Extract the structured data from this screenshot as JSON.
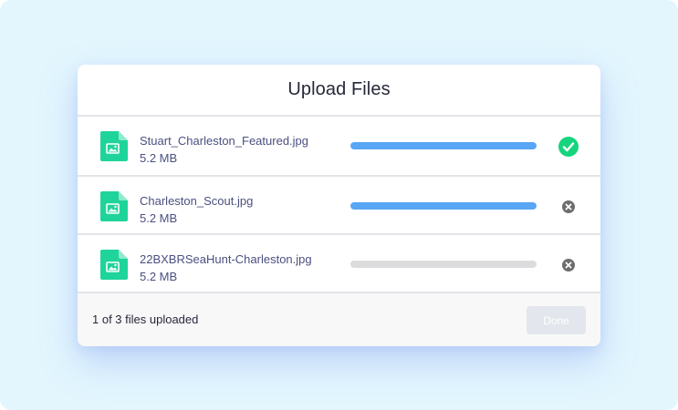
{
  "dialog": {
    "title": "Upload Files"
  },
  "files": [
    {
      "name": "Stuart_Charleston_Featured.jpg",
      "size": "5.2 MB",
      "progress": 1.0,
      "status": "complete",
      "status_icon": "check-circle-icon",
      "file_icon": "image-file-icon"
    },
    {
      "name": "Charleston_Scout.jpg",
      "size": "5.2 MB",
      "progress": 1.0,
      "status": "removable",
      "status_icon": "remove-circle-icon",
      "file_icon": "image-file-icon"
    },
    {
      "name": "22BXBRSeaHunt-Charleston.jpg",
      "size": "5.2 MB",
      "progress": 0.0,
      "status": "removable",
      "status_icon": "remove-circle-icon",
      "file_icon": "image-file-icon"
    }
  ],
  "footer": {
    "status_text": "1 of 3 files uploaded",
    "done_label": "Done",
    "done_disabled": true
  },
  "colors": {
    "background": "#e3f6fe",
    "accent_file_icon": "#1fd49a",
    "progress_fill": "#58a6f5",
    "progress_track": "#dcdcde",
    "success": "#16d47e",
    "remove_icon": "#6d6d6d",
    "button_disabled": "#e3e6ec"
  }
}
